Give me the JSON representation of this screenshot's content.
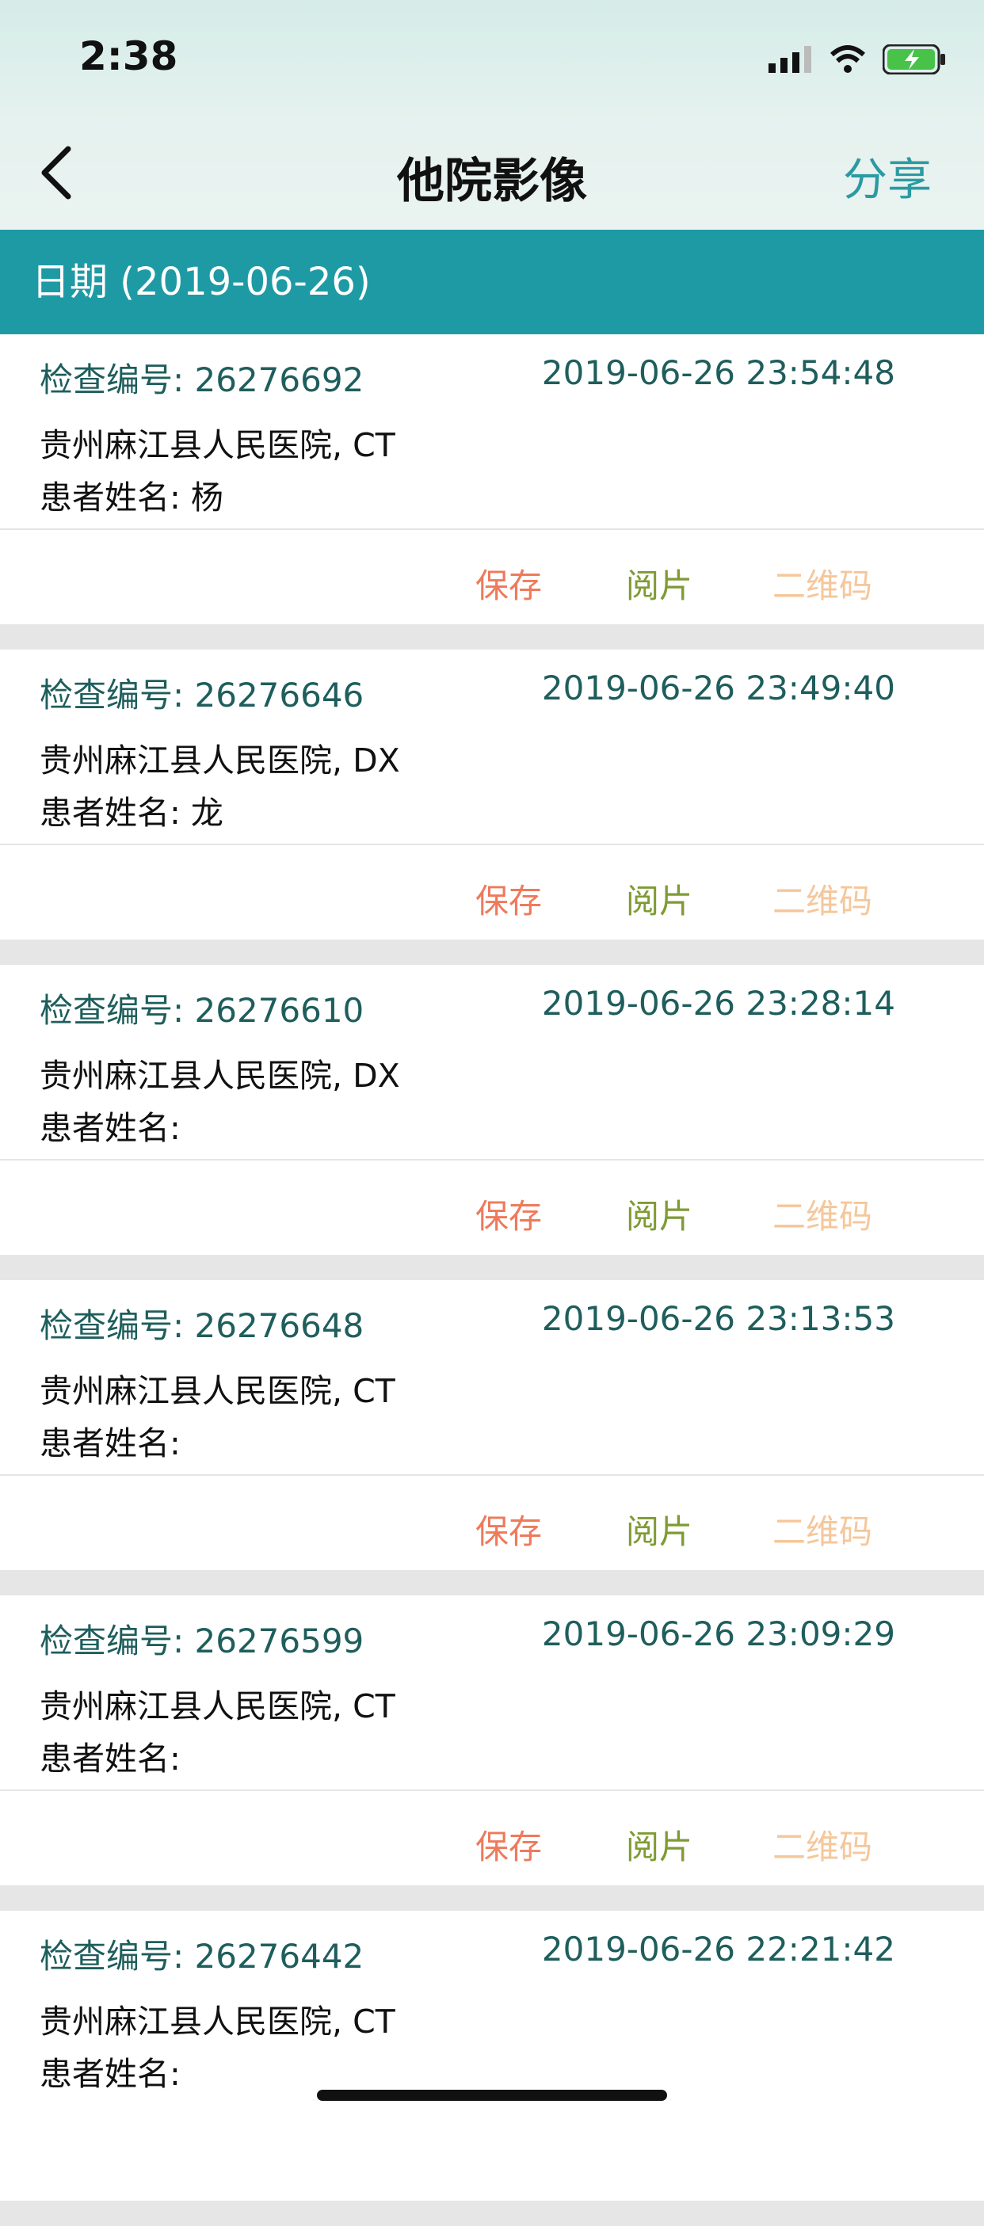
{
  "status": {
    "time": "2:38",
    "signal_icon": "cellular-signal-icon",
    "wifi_icon": "wifi-icon",
    "battery_icon": "battery-charging-icon"
  },
  "nav": {
    "back_icon": "chevron-left-icon",
    "title": "他院影像",
    "share_label": "分享"
  },
  "date_header": "日期 (2019-06-26)",
  "colors": {
    "accent": "#1e9aa5",
    "save": "#ee7a5c",
    "view": "#7f9b34",
    "qr": "#f5c79b",
    "label": "#1e5e5c"
  },
  "actions": {
    "save": "保存",
    "view": "阅片",
    "qr": "二维码"
  },
  "records": [
    {
      "exam": "检查编号: 26276692",
      "time": "2019-06-26 23:54:48",
      "hospital": "贵州麻江县人民医院, CT",
      "patient": "患者姓名: 杨"
    },
    {
      "exam": "检查编号: 26276646",
      "time": "2019-06-26 23:49:40",
      "hospital": "贵州麻江县人民医院, DX",
      "patient": "患者姓名: 龙"
    },
    {
      "exam": "检查编号: 26276610",
      "time": "2019-06-26 23:28:14",
      "hospital": "贵州麻江县人民医院, DX",
      "patient": "患者姓名:"
    },
    {
      "exam": "检查编号: 26276648",
      "time": "2019-06-26 23:13:53",
      "hospital": "贵州麻江县人民医院, CT",
      "patient": "患者姓名:"
    },
    {
      "exam": "检查编号: 26276599",
      "time": "2019-06-26 23:09:29",
      "hospital": "贵州麻江县人民医院, CT",
      "patient": "患者姓名:"
    },
    {
      "exam": "检查编号: 26276442",
      "time": "2019-06-26 22:21:42",
      "hospital": "贵州麻江县人民医院, CT",
      "patient": "患者姓名:"
    }
  ]
}
